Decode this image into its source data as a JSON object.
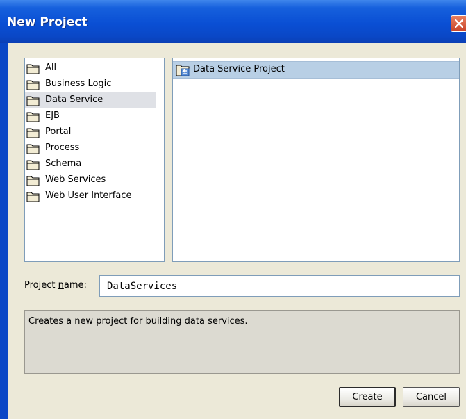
{
  "window": {
    "title": "New Project"
  },
  "categories": [
    {
      "label": "All",
      "icon": "folder-icon"
    },
    {
      "label": "Business Logic",
      "icon": "folder-icon"
    },
    {
      "label": "Data Service",
      "icon": "folder-icon"
    },
    {
      "label": "EJB",
      "icon": "folder-icon"
    },
    {
      "label": "Portal",
      "icon": "folder-icon"
    },
    {
      "label": "Process",
      "icon": "folder-icon"
    },
    {
      "label": "Schema",
      "icon": "folder-icon"
    },
    {
      "label": "Web Services",
      "icon": "folder-icon"
    },
    {
      "label": "Web User Interface",
      "icon": "folder-icon"
    }
  ],
  "selected_category": "Data Service",
  "templates": [
    {
      "label": "Data Service Project",
      "icon": "data-service-project-icon"
    }
  ],
  "project_name": {
    "label": "Project name:",
    "value": "DataServices"
  },
  "description": "Creates a new project for building data services.",
  "buttons": {
    "create": "Create",
    "cancel": "Cancel"
  },
  "colors": {
    "title_bar": "#0a47c6",
    "selection": "#b8cfe5",
    "dialog_bg": "#ece9d8"
  }
}
